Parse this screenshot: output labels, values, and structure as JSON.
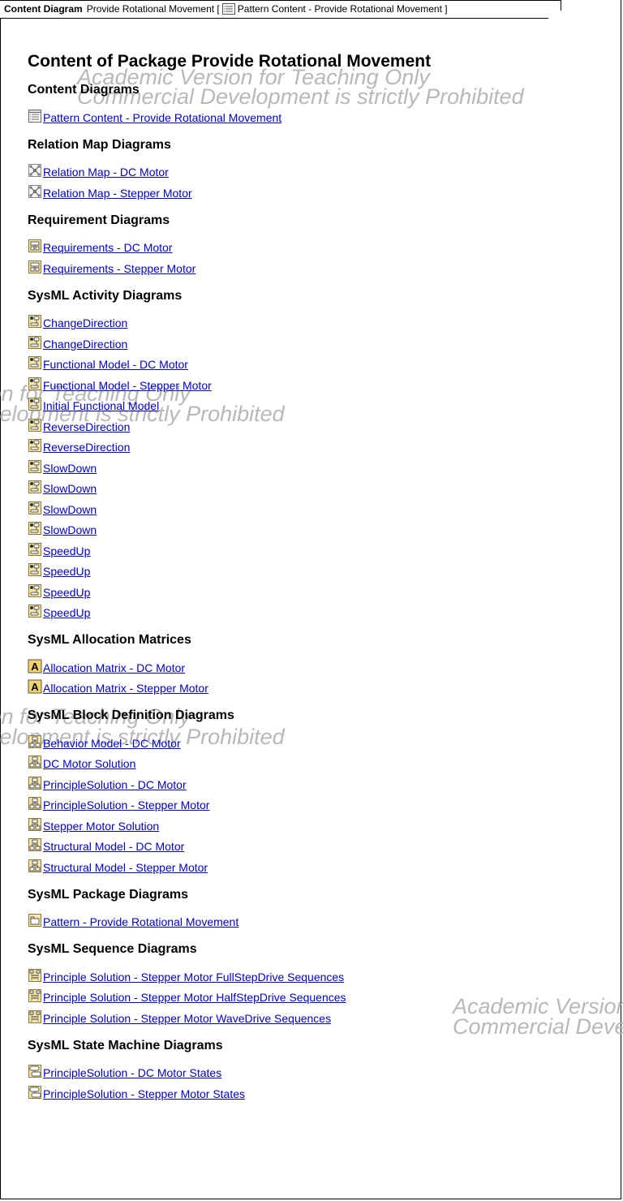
{
  "tab": {
    "type_label": "Content Diagram",
    "name_text": "Provide Rotational Movement [",
    "diagram_ref": "Pattern Content - Provide Rotational Movement ]"
  },
  "heading": "Content of Package Provide Rotational Movement",
  "watermark": {
    "line1": "Academic Version for Teaching Only",
    "line2": "Commercial Development is strictly Prohibited"
  },
  "sections": [
    {
      "title": "Content Diagrams",
      "icon": "content-diagram-icon",
      "items": [
        "Pattern Content - Provide Rotational Movement"
      ]
    },
    {
      "title": "Relation Map Diagrams",
      "icon": "relation-map-icon",
      "items": [
        "Relation Map - DC Motor",
        "Relation Map - Stepper Motor"
      ]
    },
    {
      "title": "Requirement Diagrams",
      "icon": "requirement-diagram-icon",
      "items": [
        "Requirements - DC Motor",
        "Requirements - Stepper Motor"
      ]
    },
    {
      "title": "SysML Activity Diagrams",
      "icon": "activity-diagram-icon",
      "items": [
        "ChangeDirection",
        "ChangeDirection",
        "Functional Model - DC Motor",
        "Functional Model - Stepper Motor",
        "Initial Functional Model",
        "ReverseDirection",
        "ReverseDirection",
        "SlowDown",
        "SlowDown",
        "SlowDown",
        "SlowDown",
        "SpeedUp",
        "SpeedUp",
        "SpeedUp",
        "SpeedUp"
      ]
    },
    {
      "title": "SysML Allocation Matrices",
      "icon": "allocation-matrix-icon",
      "items": [
        "Allocation Matrix - DC Motor",
        "Allocation Matrix - Stepper Motor"
      ]
    },
    {
      "title": "SysML Block Definition Diagrams",
      "icon": "block-definition-icon",
      "items": [
        "Behavior Model - DC Motor",
        "DC Motor Solution",
        "PrincipleSolution - DC Motor",
        "PrincipleSolution - Stepper Motor",
        "Stepper Motor Solution",
        "Structural Model - DC Motor",
        "Structural Model - Stepper Motor"
      ]
    },
    {
      "title": "SysML Package Diagrams",
      "icon": "package-diagram-icon",
      "items": [
        "Pattern - Provide Rotational Movement"
      ]
    },
    {
      "title": "SysML Sequence Diagrams",
      "icon": "sequence-diagram-icon",
      "items": [
        "Principle Solution - Stepper Motor FullStepDrive Sequences",
        "Principle Solution - Stepper Motor HalfStepDrive Sequences",
        "Principle Solution - Stepper Motor WaveDrive Sequences"
      ]
    },
    {
      "title": "SysML State Machine Diagrams",
      "icon": "state-machine-icon",
      "items": [
        "PrincipleSolution - DC Motor States",
        "PrincipleSolution - Stepper Motor States"
      ]
    }
  ]
}
